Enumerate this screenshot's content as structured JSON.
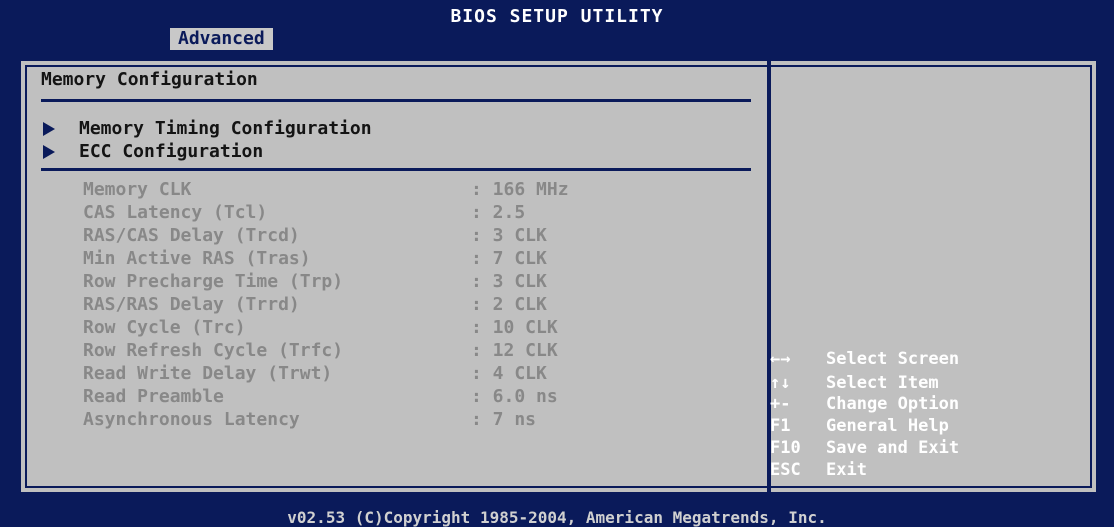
{
  "app": {
    "title": "BIOS SETUP UTILITY"
  },
  "tabs": [
    {
      "label": "Advanced",
      "active": true
    }
  ],
  "main": {
    "heading": "Memory Configuration",
    "submenus": [
      {
        "label": "Memory Timing Configuration"
      },
      {
        "label": "ECC Configuration"
      }
    ],
    "settings": [
      {
        "name": "Memory CLK",
        "value": ": 166 MHz"
      },
      {
        "name": "CAS Latency (Tcl)",
        "value": ": 2.5"
      },
      {
        "name": "RAS/CAS Delay (Trcd)",
        "value": ": 3 CLK"
      },
      {
        "name": "Min Active RAS (Tras)",
        "value": ": 7 CLK"
      },
      {
        "name": "Row Precharge Time (Trp)",
        "value": ": 3 CLK"
      },
      {
        "name": "RAS/RAS Delay (Trrd)",
        "value": ": 2 CLK"
      },
      {
        "name": "Row Cycle (Trc)",
        "value": ": 10 CLK"
      },
      {
        "name": "Row Refresh Cycle (Trfc)",
        "value": ": 12 CLK"
      },
      {
        "name": "Read Write Delay (Trwt)",
        "value": ": 4 CLK"
      },
      {
        "name": "Read Preamble",
        "value": ": 6.0 ns"
      },
      {
        "name": "Asynchronous Latency",
        "value": ": 7 ns"
      }
    ]
  },
  "help": [
    {
      "key": "←→",
      "desc": "Select Screen"
    },
    {
      "key": "↑↓",
      "desc": "Select Item"
    },
    {
      "key": "+-",
      "desc": "Change Option"
    },
    {
      "key": "F1",
      "desc": "General Help"
    },
    {
      "key": "F10",
      "desc": "Save and Exit"
    },
    {
      "key": "ESC",
      "desc": "Exit"
    }
  ],
  "footer": {
    "text": "v02.53 (C)Copyright 1985-2004, American Megatrends, Inc."
  },
  "colors": {
    "bios_blue": "#0a1a5a",
    "panel_gray": "#c0c0c0",
    "disabled_text": "#888888"
  }
}
